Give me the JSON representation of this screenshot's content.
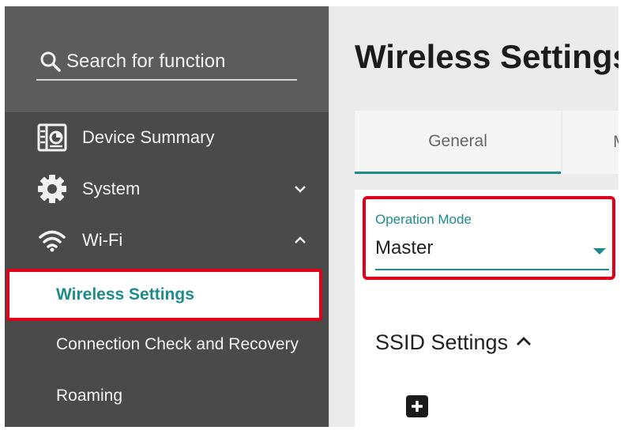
{
  "sidebar": {
    "search": {
      "placeholder": "Search for function"
    },
    "items": [
      {
        "label": "Device Summary",
        "icon": "device-summary-icon"
      },
      {
        "label": "System",
        "icon": "gear-icon",
        "expanded": false
      },
      {
        "label": "Wi-Fi",
        "icon": "wifi-icon",
        "expanded": true
      }
    ],
    "wifi_children": [
      {
        "label": "Wireless Settings",
        "active": true
      },
      {
        "label": "Connection Check and Recovery",
        "active": false
      },
      {
        "label": "Roaming",
        "active": false
      }
    ]
  },
  "main": {
    "title": "Wireless Settings",
    "tabs": [
      {
        "label": "General",
        "active": true
      },
      {
        "label": "M",
        "active": false
      }
    ],
    "operation_mode": {
      "label": "Operation Mode",
      "value": "Master"
    },
    "ssid_section": {
      "title": "SSID Settings",
      "expanded": true
    }
  },
  "colors": {
    "accent": "#1f8a8a",
    "highlight": "#e0001a",
    "sidebar_bg": "#4a4a4a",
    "sidebar_top_bg": "#5c5c5c"
  }
}
